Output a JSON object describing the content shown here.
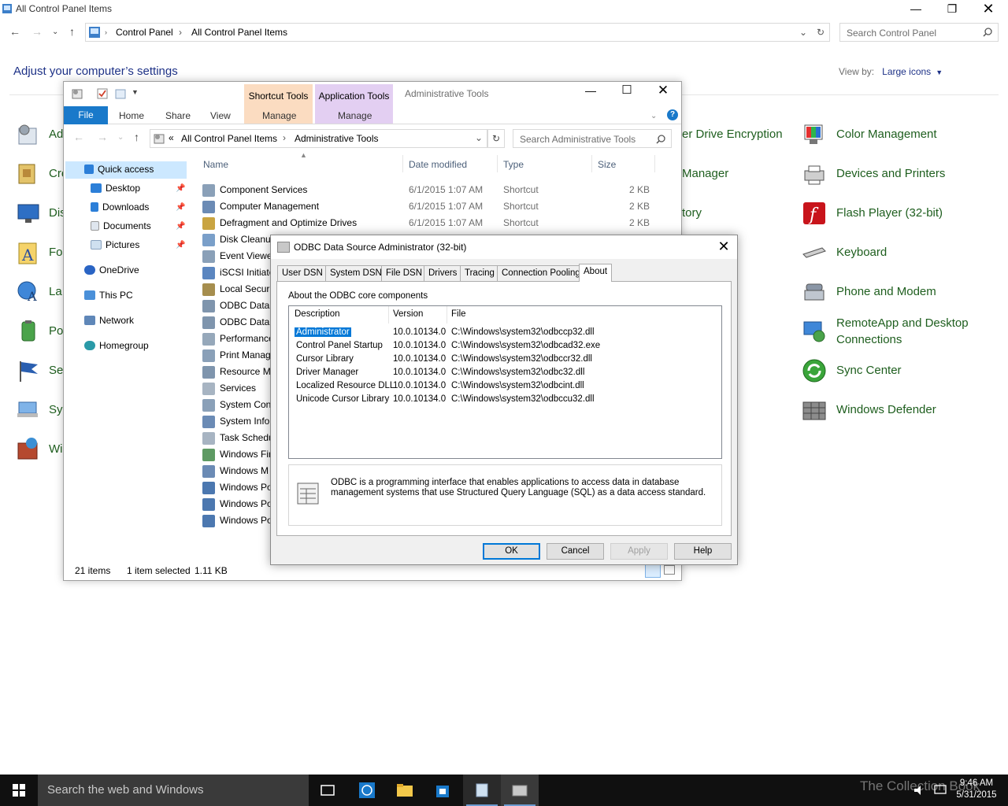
{
  "control_panel": {
    "window_title": "All Control Panel Items",
    "breadcrumb": [
      "Control Panel",
      "All Control Panel Items"
    ],
    "search_placeholder": "Search Control Panel",
    "heading": "Adjust your computer’s settings",
    "view_by_label": "View by:",
    "view_by_value": "Large icons",
    "left_items": [
      "Ad",
      "Cre",
      "Dis",
      "Fo",
      "La",
      "Po",
      "Se",
      "Sy",
      "Wi"
    ],
    "partial_items": [
      "er Drive Encryption",
      "Manager",
      "tory"
    ],
    "right_items": [
      "Color Management",
      "Devices and Printers",
      "Flash Player (32-bit)",
      "Keyboard",
      "Phone and Modem",
      "RemoteApp and Desktop Connections",
      "Sync Center",
      "Windows Defender"
    ]
  },
  "admin_tools": {
    "title": "Administrative Tools",
    "context_tabs": [
      {
        "label": "Shortcut Tools",
        "sub": "Manage",
        "color": "#fbdcc1"
      },
      {
        "label": "Application Tools",
        "sub": "Manage",
        "color": "#e3cff2"
      }
    ],
    "ribbon_tabs": [
      "File",
      "Home",
      "Share",
      "View"
    ],
    "breadcrumb_prefix": "«",
    "breadcrumb": [
      "All Control Panel Items",
      "Administrative Tools"
    ],
    "search_placeholder": "Search Administrative Tools",
    "nav": {
      "quick_access": "Quick access",
      "pinned": [
        "Desktop",
        "Downloads",
        "Documents",
        "Pictures"
      ],
      "onedrive": "OneDrive",
      "this_pc": "This PC",
      "network": "Network",
      "homegroup": "Homegroup"
    },
    "columns": [
      "Name",
      "Date modified",
      "Type",
      "Size"
    ],
    "files": [
      {
        "name": "Component Services",
        "date": "6/1/2015 1:07 AM",
        "type": "Shortcut",
        "size": "2 KB"
      },
      {
        "name": "Computer Management",
        "date": "6/1/2015 1:07 AM",
        "type": "Shortcut",
        "size": "2 KB"
      },
      {
        "name": "Defragment and Optimize Drives",
        "date": "6/1/2015 1:07 AM",
        "type": "Shortcut",
        "size": "2 KB"
      },
      {
        "name": "Disk Cleanup",
        "date": "",
        "type": "",
        "size": ""
      },
      {
        "name": "Event Viewe",
        "date": "",
        "type": "",
        "size": ""
      },
      {
        "name": "iSCSI Initiato",
        "date": "",
        "type": "",
        "size": ""
      },
      {
        "name": "Local Securi",
        "date": "",
        "type": "",
        "size": ""
      },
      {
        "name": "ODBC Data",
        "date": "",
        "type": "",
        "size": ""
      },
      {
        "name": "ODBC Data",
        "date": "",
        "type": "",
        "size": ""
      },
      {
        "name": "Performance",
        "date": "",
        "type": "",
        "size": ""
      },
      {
        "name": "Print Manag",
        "date": "",
        "type": "",
        "size": ""
      },
      {
        "name": "Resource M",
        "date": "",
        "type": "",
        "size": ""
      },
      {
        "name": "Services",
        "date": "",
        "type": "",
        "size": ""
      },
      {
        "name": "System Conf",
        "date": "",
        "type": "",
        "size": ""
      },
      {
        "name": "System Infor",
        "date": "",
        "type": "",
        "size": ""
      },
      {
        "name": "Task Schedu",
        "date": "",
        "type": "",
        "size": ""
      },
      {
        "name": "Windows Fir",
        "date": "",
        "type": "",
        "size": ""
      },
      {
        "name": "Windows M",
        "date": "",
        "type": "",
        "size": ""
      },
      {
        "name": "Windows Po",
        "date": "",
        "type": "",
        "size": ""
      },
      {
        "name": "Windows Po",
        "date": "",
        "type": "",
        "size": ""
      },
      {
        "name": "Windows Po",
        "date": "",
        "type": "",
        "size": ""
      }
    ],
    "status_count": "21 items",
    "status_selected": "1 item selected",
    "status_size": "1.11 KB"
  },
  "odbc": {
    "title": "ODBC Data Source Administrator (32-bit)",
    "tabs": [
      "User DSN",
      "System DSN",
      "File DSN",
      "Drivers",
      "Tracing",
      "Connection Pooling",
      "About"
    ],
    "active_tab": "About",
    "section_label": "About the ODBC core components",
    "columns": [
      "Description",
      "Version",
      "File"
    ],
    "components": [
      {
        "description": "Administrator",
        "version": "10.0.10134.0",
        "file": "C:\\Windows\\system32\\odbccp32.dll"
      },
      {
        "description": "Control Panel Startup",
        "version": "10.0.10134.0",
        "file": "C:\\Windows\\system32\\odbcad32.exe"
      },
      {
        "description": "Cursor Library",
        "version": "10.0.10134.0",
        "file": "C:\\Windows\\system32\\odbccr32.dll"
      },
      {
        "description": "Driver Manager",
        "version": "10.0.10134.0",
        "file": "C:\\Windows\\system32\\odbc32.dll"
      },
      {
        "description": "Localized Resource DLL",
        "version": "10.0.10134.0",
        "file": "C:\\Windows\\system32\\odbcint.dll"
      },
      {
        "description": "Unicode Cursor Library",
        "version": "10.0.10134.0",
        "file": "C:\\Windows\\system32\\odbccu32.dll"
      }
    ],
    "info_text": "ODBC is a programming interface that enables applications to access data in database management systems that use Structured Query Language (SQL) as a data access standard.",
    "buttons": {
      "ok": "OK",
      "cancel": "Cancel",
      "apply": "Apply",
      "help": "Help"
    }
  },
  "taskbar": {
    "search_placeholder": "Search the web and Windows",
    "time": "9:46 AM",
    "date": "5/31/2015",
    "watermark": "The Collection Book"
  }
}
